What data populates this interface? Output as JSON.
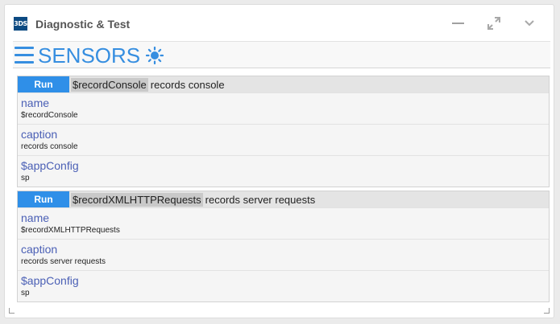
{
  "window": {
    "title": "Diagnostic & Test",
    "logo_text": "3DS"
  },
  "toolbar": {
    "heading": "SENSORS"
  },
  "sensors": [
    {
      "run_label": "Run",
      "command": "$recordConsole",
      "description": "records console",
      "fields": [
        {
          "label": "name",
          "value": "$recordConsole"
        },
        {
          "label": "caption",
          "value": "records console"
        },
        {
          "label": "$appConfig",
          "value": "sp"
        }
      ]
    },
    {
      "run_label": "Run",
      "command": "$recordXMLHTTPRequests",
      "description": "records server requests",
      "fields": [
        {
          "label": "name",
          "value": "$recordXMLHTTPRequests"
        },
        {
          "label": "caption",
          "value": "records server requests"
        },
        {
          "label": "$appConfig",
          "value": "sp"
        }
      ]
    }
  ],
  "colors": {
    "accent": "#368ee0",
    "run_button": "#2f8fe8",
    "field_label": "#4a5fb5"
  }
}
